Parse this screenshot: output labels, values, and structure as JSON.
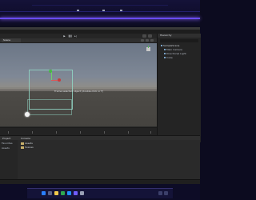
{
  "app": {
    "window_title": "Unity Editor"
  },
  "toolbar": {
    "play_icon": "play-icon",
    "pause_icon": "pause-icon",
    "step_icon": "step-icon"
  },
  "scene": {
    "tab_label": "Scene",
    "overlay_text": "Frame selected object (double-click or F)",
    "light_icon": "directional-light-icon"
  },
  "hierarchy": {
    "tab_label": "Hierarchy",
    "items": [
      {
        "label": "SampleScene",
        "root": true
      },
      {
        "label": "Main Camera",
        "root": false
      },
      {
        "label": "Directional Light",
        "root": false
      },
      {
        "label": "Cube",
        "root": false
      }
    ]
  },
  "bottom": {
    "tabs": [
      "Project",
      "Console"
    ],
    "left_items": [
      "Favorites",
      "Assets"
    ],
    "folders": [
      "Assets",
      "Scenes"
    ]
  },
  "colors": {
    "editor_bg": "#2b2b2b",
    "neon_accent": "#6a4cff",
    "selection_outline": "#91d6c4"
  }
}
